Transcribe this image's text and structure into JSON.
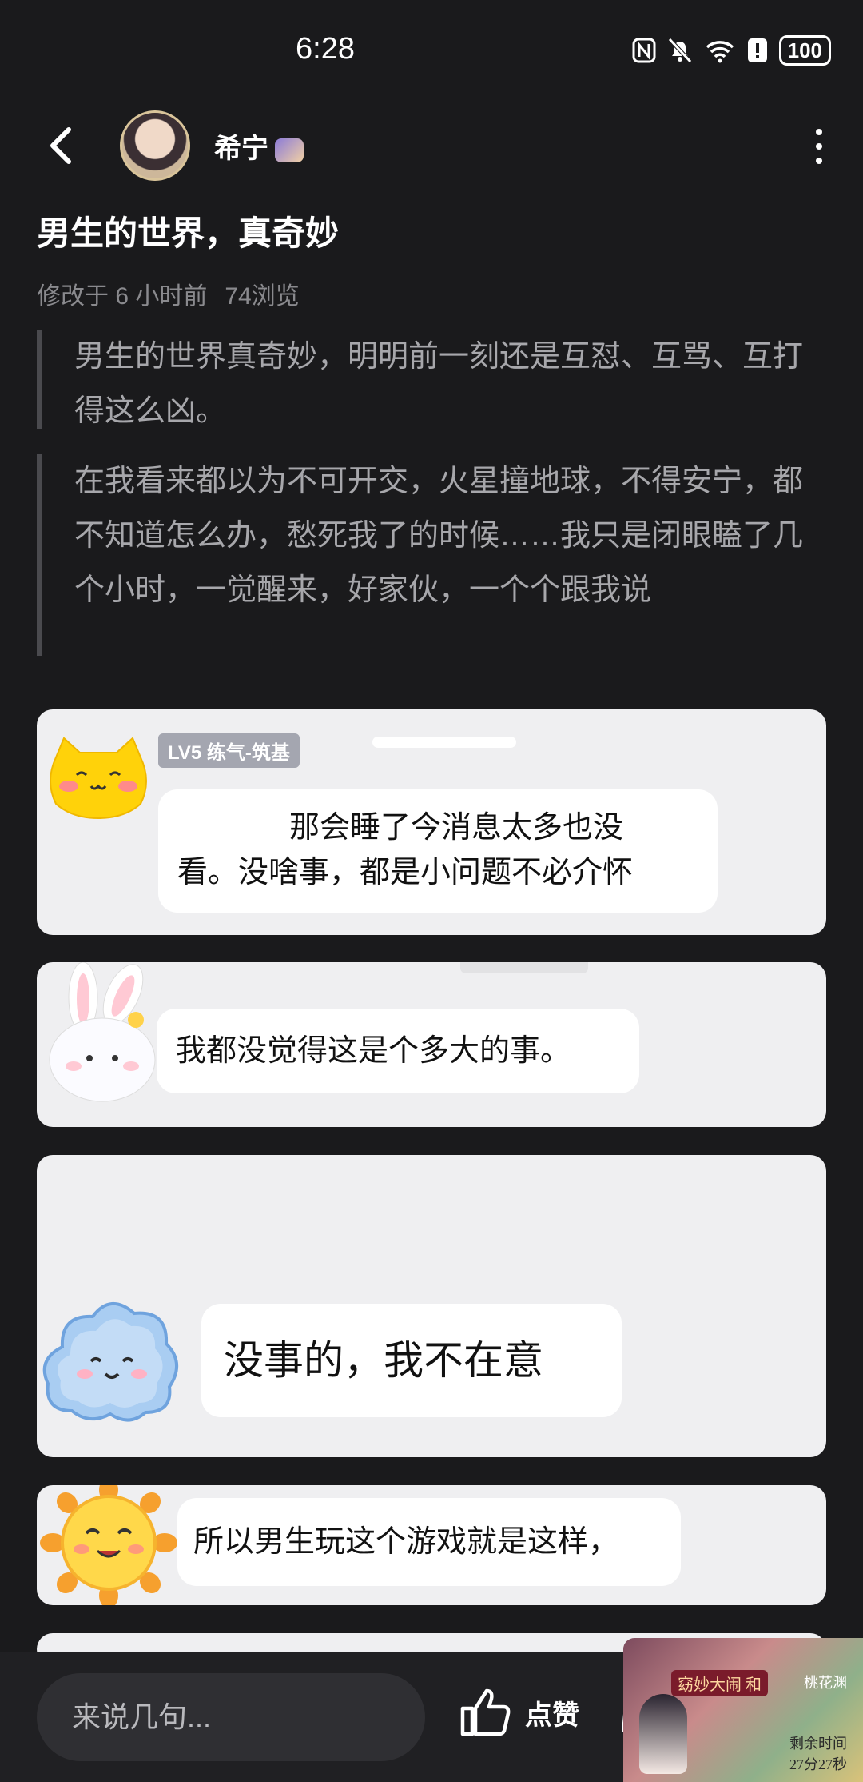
{
  "status": {
    "time": "6:28",
    "battery": "100"
  },
  "header": {
    "author": "希宁"
  },
  "post": {
    "title": "男生的世界，真奇妙",
    "modified": "修改于 6 小时前",
    "views": "74浏览",
    "paragraphs": [
      "男生的世界真奇妙，明明前一刻还是互怼、互骂、互打得这么凶。",
      "在我看来都以为不可开交，火星撞地球，不得安宁，都不知道怎么办，愁死我了的时候……我只是闭眼瞌了几个小时，一觉醒来，好家伙，一个个跟我说"
    ]
  },
  "messages": [
    {
      "level": "LV5 练气-筑基",
      "text_line1": "那会睡了今消息太多也没",
      "text_line2": "看。没啥事，都是小问题不必介怀"
    },
    {
      "text": "我都没觉得这是个多大的事。"
    },
    {
      "text": "没事的，我不在意"
    },
    {
      "text": "所以男生玩这个游戏就是这样，"
    }
  ],
  "bottom": {
    "comment_placeholder": "来说几句...",
    "like_label": "点赞"
  },
  "game_overlay": {
    "title": "窈妙大闹",
    "sub": "和",
    "side": "桃花渊",
    "timer_label": "剩余时间",
    "timer": "27分27秒"
  },
  "colors": {
    "background": "#1a1a1c",
    "card": "#efeff1",
    "quote_bar": "#4a4a4e"
  }
}
